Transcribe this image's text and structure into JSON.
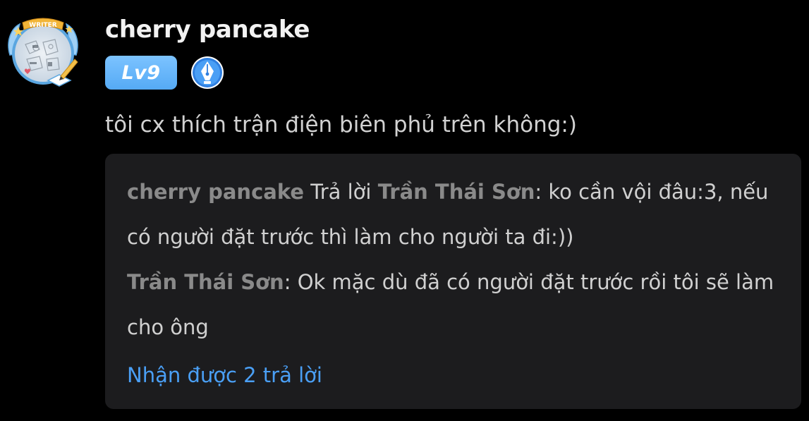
{
  "user": {
    "name": "cherry pancake",
    "level": "Lv9",
    "avatar_badge_text": "WRITER"
  },
  "comment": {
    "text": "tôi cx thích trận điện biên phủ trên không:)"
  },
  "replies": [
    {
      "author": "cherry pancake",
      "reply_word": "Trả lời",
      "target": "Trần Thái Sơn",
      "text": ": ko cần vội đâu:3, nếu có người đặt trước thì làm cho người ta đi:))"
    },
    {
      "author": "Trần Thái Sơn",
      "text": ": Ok mặc dù đã có người đặt trước rồi tôi sẽ làm cho ông"
    }
  ],
  "more_replies_label": "Nhận được 2 trả lời",
  "colors": {
    "background": "#000000",
    "reply_box": "#1c1c1e",
    "link_blue": "#4a9ff5",
    "level_badge": "#6ab7fb",
    "reply_name": "#8a8a8a"
  },
  "icons": {
    "avatar": "writer-avatar-frame",
    "pen_badge": "fountain-pen-nib-icon"
  }
}
